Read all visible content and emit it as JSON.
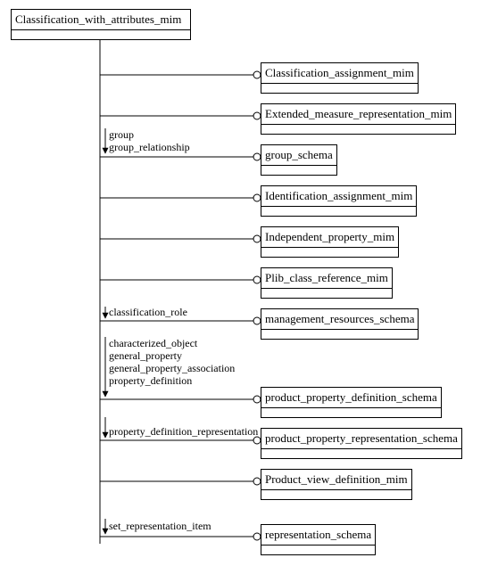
{
  "root": {
    "label": "Classification_with_attributes_mim"
  },
  "targets": [
    {
      "label": "Classification_assignment_mim"
    },
    {
      "label": "Extended_measure_representation_mim"
    },
    {
      "label": "group_schema"
    },
    {
      "label": "Identification_assignment_mim"
    },
    {
      "label": "Independent_property_mim"
    },
    {
      "label": "Plib_class_reference_mim"
    },
    {
      "label": "management_resources_schema"
    },
    {
      "label": "product_property_definition_schema"
    },
    {
      "label": "product_property_representation_schema"
    },
    {
      "label": "Product_view_definition_mim"
    },
    {
      "label": "representation_schema"
    }
  ],
  "edge_labels": {
    "group": "group",
    "group_relationship": "group_relationship",
    "classification_role": "classification_role",
    "characterized_object": "characterized_object",
    "general_property": "general_property",
    "general_property_association": "general_property_association",
    "property_definition": "property_definition",
    "property_definition_representation": "property_definition_representation",
    "set_representation_item": "set_representation_item"
  }
}
